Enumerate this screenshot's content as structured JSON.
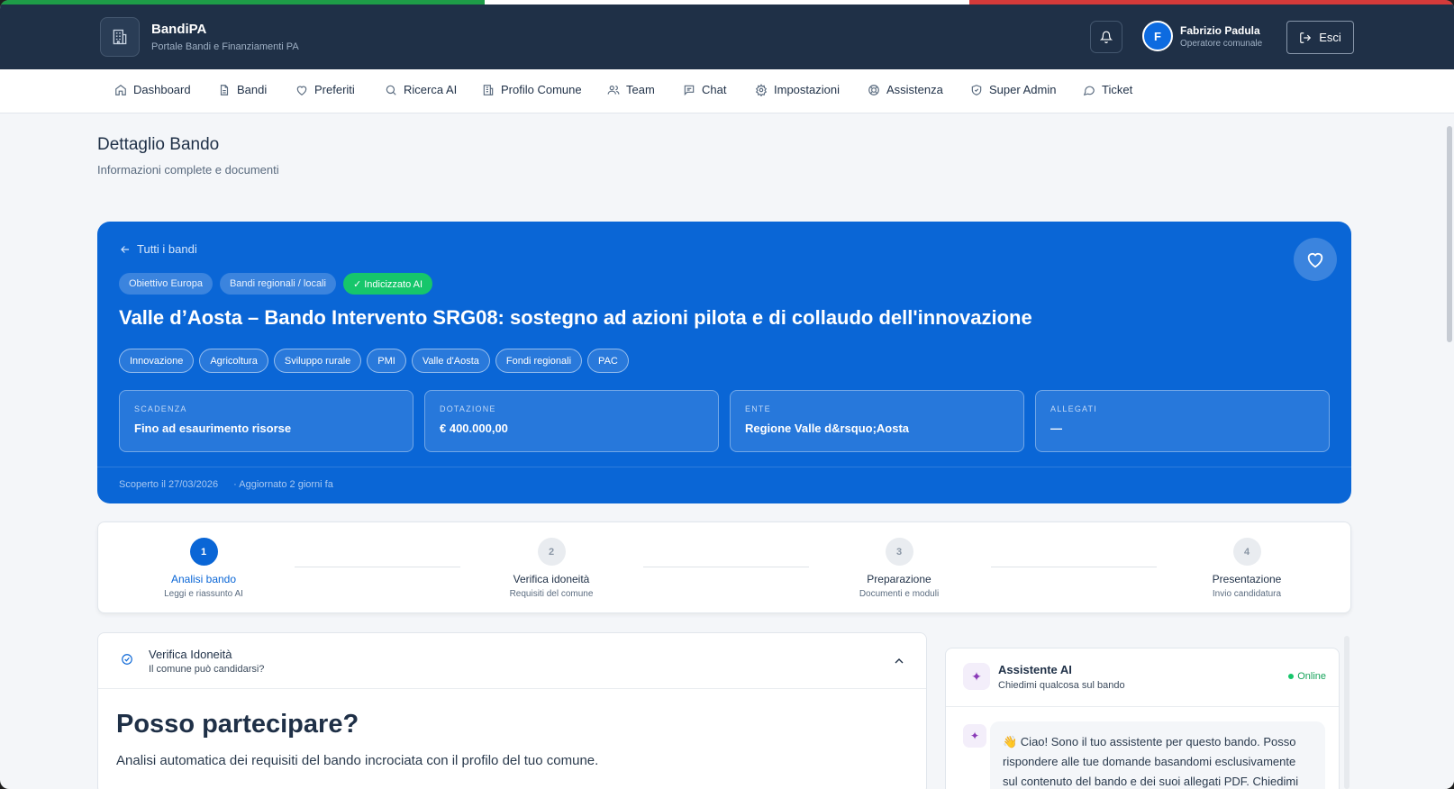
{
  "header": {
    "brand_title": "BandiPA",
    "brand_subtitle": "Portale Bandi e Finanziamenti PA",
    "user_initial": "F",
    "user_name": "Fabrizio Padula",
    "user_role": "Operatore comunale",
    "logout_label": "Esci",
    "flag_colors": [
      "#1e9c48",
      "#ffffff",
      "#d43a3a"
    ]
  },
  "nav": {
    "items": [
      {
        "label": "Dashboard",
        "icon": "home-icon"
      },
      {
        "label": "Bandi",
        "icon": "document-icon"
      },
      {
        "label": "Preferiti",
        "icon": "heart-icon"
      },
      {
        "label": "Ricerca AI",
        "icon": "search-icon"
      },
      {
        "label": "Profilo Comune",
        "icon": "building-icon"
      },
      {
        "label": "Team",
        "icon": "users-icon"
      },
      {
        "label": "Chat",
        "icon": "chat-icon"
      },
      {
        "label": "Impostazioni",
        "icon": "gear-icon"
      },
      {
        "label": "Assistenza",
        "icon": "lifebuoy-icon"
      },
      {
        "label": "Super Admin",
        "icon": "shield-icon"
      },
      {
        "label": "Ticket",
        "icon": "message-circle-icon"
      }
    ]
  },
  "page": {
    "title": "Dettaglio Bando",
    "subtitle": "Informazioni complete e documenti"
  },
  "bando": {
    "back_label": "Tutti i bandi",
    "badges": [
      "Obiettivo Europa",
      "Bandi regionali / locali",
      "✓ Indicizzato AI"
    ],
    "title": "Valle d’Aosta – Bando Intervento SRG08: sostegno ad azioni pilota e di collaudo dell'innovazione",
    "tags": [
      "Innovazione",
      "Agricoltura",
      "Sviluppo rurale",
      "PMI",
      "Valle d'Aosta",
      "Fondi regionali",
      "PAC"
    ],
    "stats": [
      {
        "label": "SCADENZA",
        "value": "Fino ad esaurimento risorse"
      },
      {
        "label": "DOTAZIONE",
        "value": "€ 400.000,00"
      },
      {
        "label": "ENTE",
        "value": "Regione Valle d&rsquo;Aosta"
      },
      {
        "label": "ALLEGATI",
        "value": "—"
      }
    ],
    "discovered": "Scoperto il 27/03/2026",
    "updated": "· Aggiornato 2 giorni fa",
    "accent_color": "#0a66d6"
  },
  "steps": [
    {
      "number": "1",
      "label": "Analisi bando",
      "sub": "Leggi e riassunto AI",
      "active": true
    },
    {
      "number": "2",
      "label": "Verifica idoneità",
      "sub": "Requisiti del comune",
      "active": false
    },
    {
      "number": "3",
      "label": "Preparazione",
      "sub": "Documenti e moduli",
      "active": false
    },
    {
      "number": "4",
      "label": "Presentazione",
      "sub": "Invio candidatura",
      "active": false
    }
  ],
  "verifica": {
    "title": "Verifica Idoneità",
    "subtitle": "Il comune può candidarsi?",
    "heading": "Posso partecipare?",
    "description": "Analisi automatica dei requisiti del bando incrociata con il profilo del tuo comune."
  },
  "assistant": {
    "title": "Assistente AI",
    "subtitle": "Chiedimi qualcosa sul bando",
    "status": "Online",
    "message": "👋 Ciao! Sono il tuo assistente per questo bando. Posso rispondere alle tue domande basandomi esclusivamente sul contenuto del bando e dei suoi allegati PDF. Chiedimi"
  }
}
